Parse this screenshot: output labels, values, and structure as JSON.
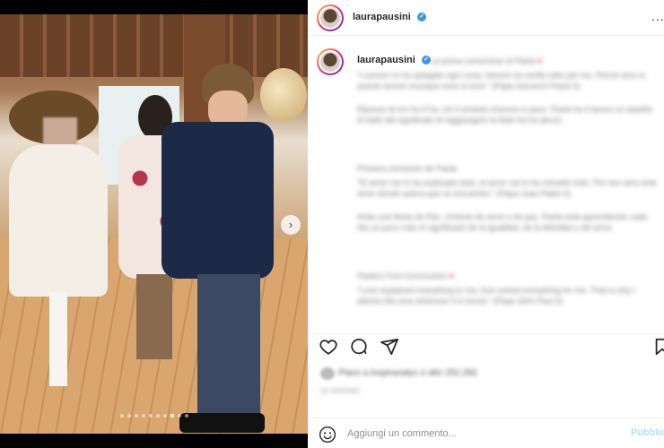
{
  "header": {
    "username": "laurapausini",
    "verified": true,
    "more_label": "..."
  },
  "media": {
    "next_label": "›",
    "dots_total": 10,
    "dots_active": 8
  },
  "caption": {
    "username": "laurapausini",
    "intro_blurred": "La prima comunione di Paola",
    "paragraphs_blurred": [
      "\"L'amore mi ha spiegato ogni cosa, l'amore ha risolto tutto per me. Perciò amo io questo amore ovunque esso si trovi.\" (Papa Giovanni Paolo II)",
      "Ripasso di oro fa il Fra. ciò il simbolo d'amore e pace. Paola ha il lavoro un aspetto di bello del significato di raggiungere la fede tra tra alcuni.",
      "Primera comunión de Paola",
      "\"El amor me lo ha explicado todo, el amor me lo ha resuelto todo. Por eso amo este amor donde quiera que se encuentre.\" (Papa Juan Pablo II)",
      "Anita una fiesta de Paz, símbolo de amor y de paz. Paola está aprendiendo cada día un poco más el significado de la igualdad, de la felicidad y del amor.",
      "Paola's First Communion",
      "\"Love explained everything to me, love solved everything for me. That is why I admire this love wherever it is found.\" (Pope John Paul II)"
    ]
  },
  "actions": {
    "like_icon": "heart-outline-icon",
    "comment_icon": "comment-bubble-icon",
    "share_icon": "paper-plane-icon",
    "save_icon": "bookmark-icon"
  },
  "likes_blurred": "Piace a lospiranalys e altri 252.392",
  "date_blurred": "22 GIUGNO",
  "composer": {
    "placeholder": "Aggiungi un commento...",
    "publish_label": "Pubblica",
    "emoji_icon": "smiley-icon"
  },
  "colors": {
    "verified_blue": "#3897f0",
    "publish_blue": "#b2dffc",
    "heart_red": "#ed4956"
  }
}
